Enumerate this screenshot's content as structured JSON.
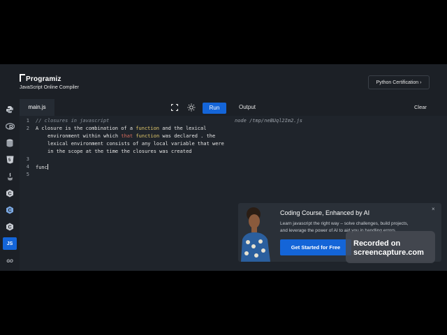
{
  "header": {
    "brand": "Programiz",
    "subtitle": "JavaScript Online Compiler",
    "cert_button": "Python Certification"
  },
  "sidebar": {
    "items": [
      {
        "icon": "python-icon"
      },
      {
        "icon": "r-icon"
      },
      {
        "icon": "sql-icon"
      },
      {
        "icon": "html-icon"
      },
      {
        "icon": "java-icon"
      },
      {
        "icon": "c-icon"
      },
      {
        "icon": "cplusplus-icon"
      },
      {
        "icon": "csharp-icon"
      },
      {
        "icon": "js-icon",
        "label": "JS",
        "active": true
      },
      {
        "icon": "go-icon",
        "label": "GO"
      }
    ]
  },
  "editor": {
    "tab": "main.js",
    "run_label": "Run",
    "line_numbers": [
      "1",
      "2",
      "",
      "",
      "",
      "3",
      "4",
      "5"
    ],
    "lines": {
      "l1": "// closures in javascript",
      "l2a": "A closure is the combination of a ",
      "l2b": "function",
      "l2c": " and the lexical",
      "l2d": "environment within which ",
      "l2e": "that",
      "l2f": " ",
      "l2g": "function",
      "l2h": " was declared . the",
      "l2i": "lexical environment consists of any local variable that were",
      "l2j": "in the scope at the time the closures was created",
      "l4": "func"
    }
  },
  "output": {
    "title": "Output",
    "clear_label": "Clear",
    "text": "node /tmp/neBUql2Im2.js"
  },
  "ad": {
    "title": "Coding Course, Enhanced by AI",
    "desc1": "Learn javascript the right way – solve challenges, build projects,",
    "desc2": "and leverage the power of AI to aid you in handling errors.",
    "cta": "Get Started for Free",
    "close": "×"
  },
  "watermark": {
    "line1": "Recorded on",
    "line2": "screencapture.com"
  },
  "colors": {
    "accent": "#1465d8",
    "background": "#1f242b",
    "header": "#1c2026"
  }
}
